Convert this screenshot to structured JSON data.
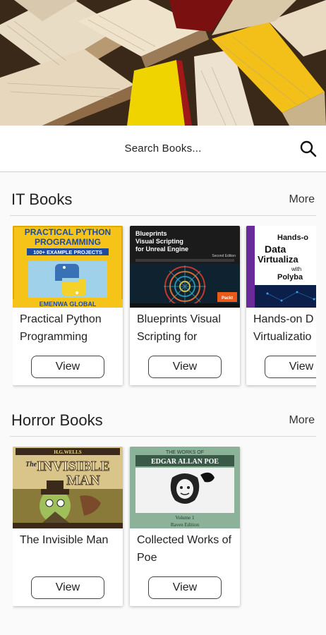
{
  "search": {
    "placeholder": "Search Books..."
  },
  "sections": [
    {
      "title": "IT Books",
      "more_label": "More",
      "books": [
        {
          "title": "Practical Python Programming",
          "cover_title": "PRACTICAL PYTHON PROGRAMMING",
          "cover_sub": "100+ EXAMPLE PROJECTS",
          "cover_author": "EMENWA GLOBAL",
          "view_label": "View"
        },
        {
          "title": "Blueprints Visual Scripting for",
          "cover_title": "Blueprints Visual Scripting for Unreal Engine",
          "cover_sub": "Second Edition",
          "cover_badge": "Packt",
          "view_label": "View"
        },
        {
          "title": "Hands-on D Virtualizatio",
          "cover_title": "Hands-o Data Virtualiza Polyba",
          "view_label": "View"
        }
      ]
    },
    {
      "title": "Horror Books",
      "more_label": "More",
      "books": [
        {
          "title": "The Invisible Man",
          "cover_title": "Invisible Man",
          "cover_sub": "The",
          "cover_author": "H.G.WELLS",
          "view_label": "View"
        },
        {
          "title": "Collected Works of Poe",
          "cover_top": "THE WORKS OF",
          "cover_title": "EDGAR ALLAN POE",
          "cover_sub": "Volume 1",
          "cover_author": "Raven Edition",
          "view_label": "View"
        }
      ]
    }
  ]
}
